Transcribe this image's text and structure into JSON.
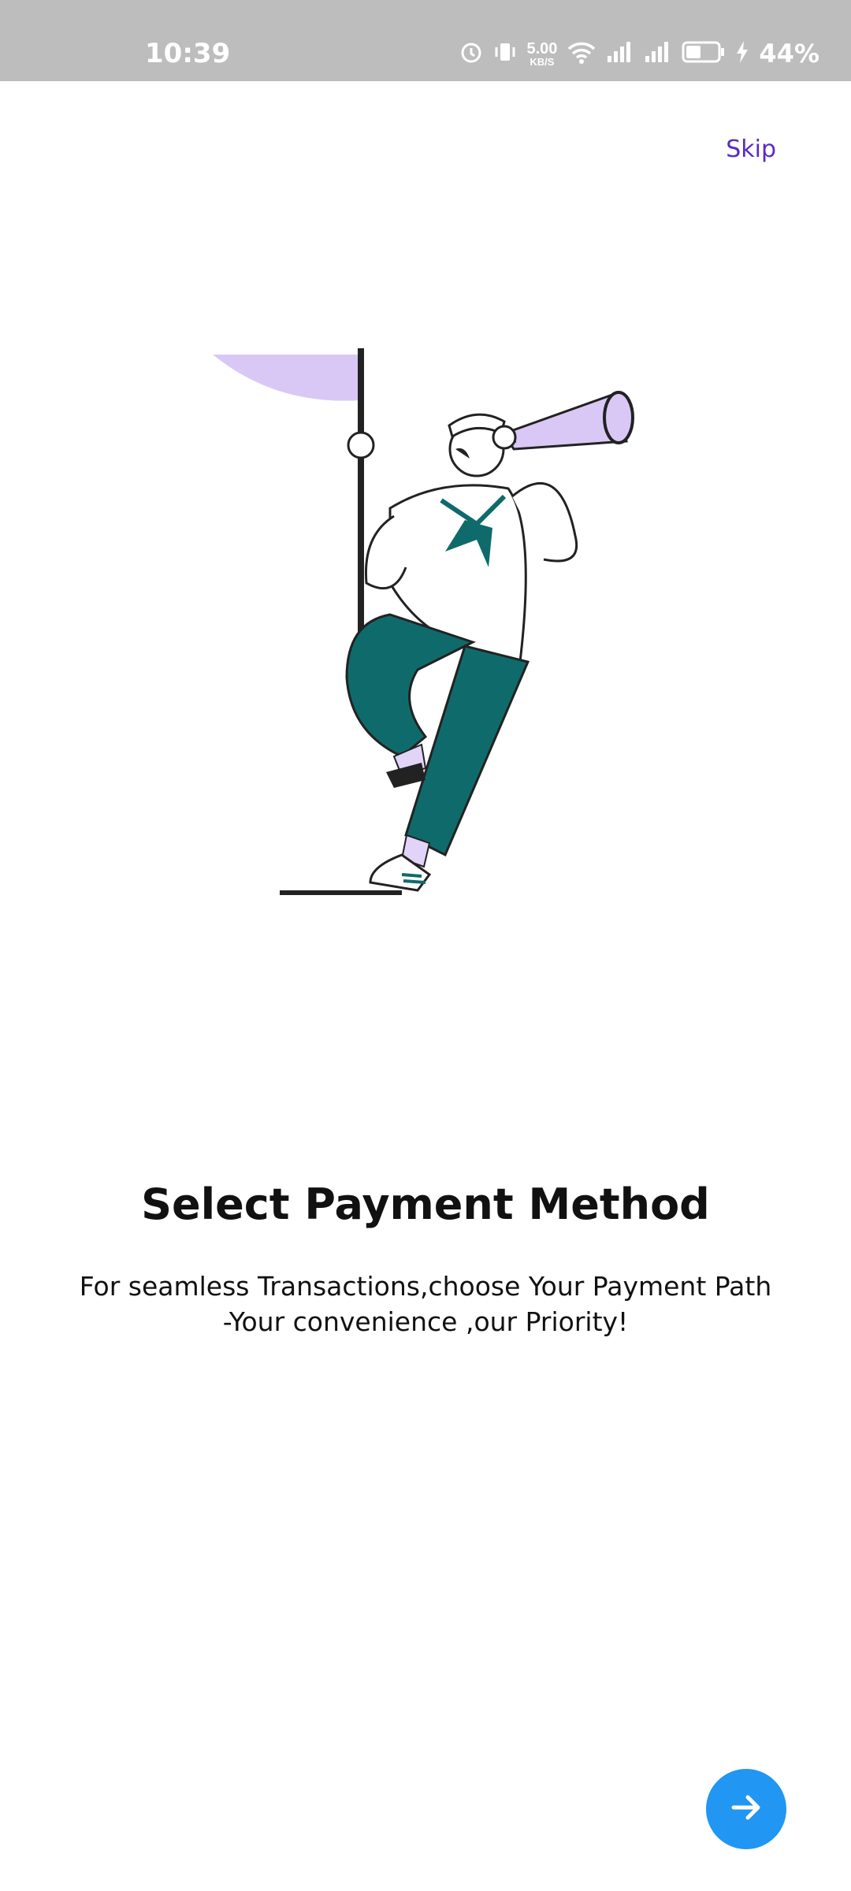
{
  "status_bar": {
    "time": "10:39",
    "net_speed_value": "5.00",
    "net_speed_unit": "KB/S",
    "battery_percent": "44%",
    "icons": [
      "alarm-icon",
      "vibrate-icon",
      "wifi-icon",
      "signal-icon",
      "signal-icon",
      "battery-icon",
      "charging-icon"
    ]
  },
  "header": {
    "skip_label": "Skip"
  },
  "onboarding": {
    "title": "Select Payment Method",
    "subtitle_line1": "For seamless Transactions,choose Your Payment Path",
    "subtitle_line2": "-Your convenience ,our Priority!"
  },
  "footer": {
    "next_icon": "arrow-right-icon"
  },
  "colors": {
    "accent": "#2196f3",
    "skip": "#5b2bc4",
    "illustration_teal": "#0f6b6b",
    "illustration_lavender": "#d9c8f5"
  }
}
